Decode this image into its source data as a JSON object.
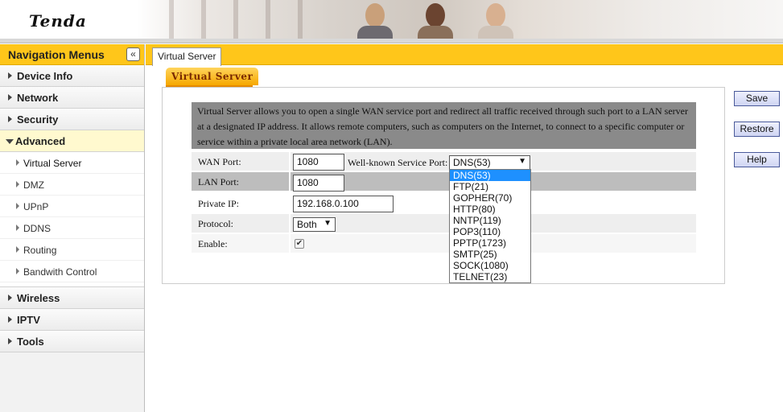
{
  "header": {
    "logo_text": "Tenda"
  },
  "sidebar": {
    "title": "Navigation Menus",
    "collapse_glyph": "«",
    "items": [
      {
        "label": "Device Info"
      },
      {
        "label": "Network"
      },
      {
        "label": "Security"
      },
      {
        "label": "Advanced",
        "expanded": true,
        "children": [
          {
            "label": "Virtual Server",
            "active": true
          },
          {
            "label": "DMZ"
          },
          {
            "label": "UPnP"
          },
          {
            "label": "DDNS"
          },
          {
            "label": "Routing"
          },
          {
            "label": "Bandwith Control"
          }
        ]
      },
      {
        "label": "Wireless"
      },
      {
        "label": "IPTV"
      },
      {
        "label": "Tools"
      }
    ]
  },
  "tabs": {
    "page_tab": "Virtual Server",
    "section_tab": "Virtual Server"
  },
  "description": "Virtual Server allows you to open a single WAN service port and redirect all traffic received through such port to a LAN server at a designated IP address. It allows remote computers, such as computers on the Internet, to connect to a specific computer or service within a private local area network (LAN).",
  "form": {
    "wan_port": {
      "label": "WAN Port:",
      "value": "1080"
    },
    "well_known": {
      "label": "Well-known Service Port:",
      "value": "DNS(53)"
    },
    "lan_port": {
      "label": "LAN Port:",
      "value": "1080"
    },
    "private_ip": {
      "label": "Private IP:",
      "value": "192.168.0.100"
    },
    "protocol": {
      "label": "Protocol:",
      "value": "Both"
    },
    "enable": {
      "label": "Enable:",
      "checked": true
    }
  },
  "dropdown": {
    "options": [
      "DNS(53)",
      "FTP(21)",
      "GOPHER(70)",
      "HTTP(80)",
      "NNTP(119)",
      "POP3(110)",
      "PPTP(1723)",
      "SMTP(25)",
      "SOCK(1080)",
      "TELNET(23)"
    ],
    "selected_index": 0,
    "highlight_color": "#1e90ff"
  },
  "buttons": {
    "save": "Save",
    "restore": "Restore",
    "help": "Help"
  },
  "colors": {
    "accent": "#ffc61a",
    "description_bg": "#8a8a8a"
  }
}
